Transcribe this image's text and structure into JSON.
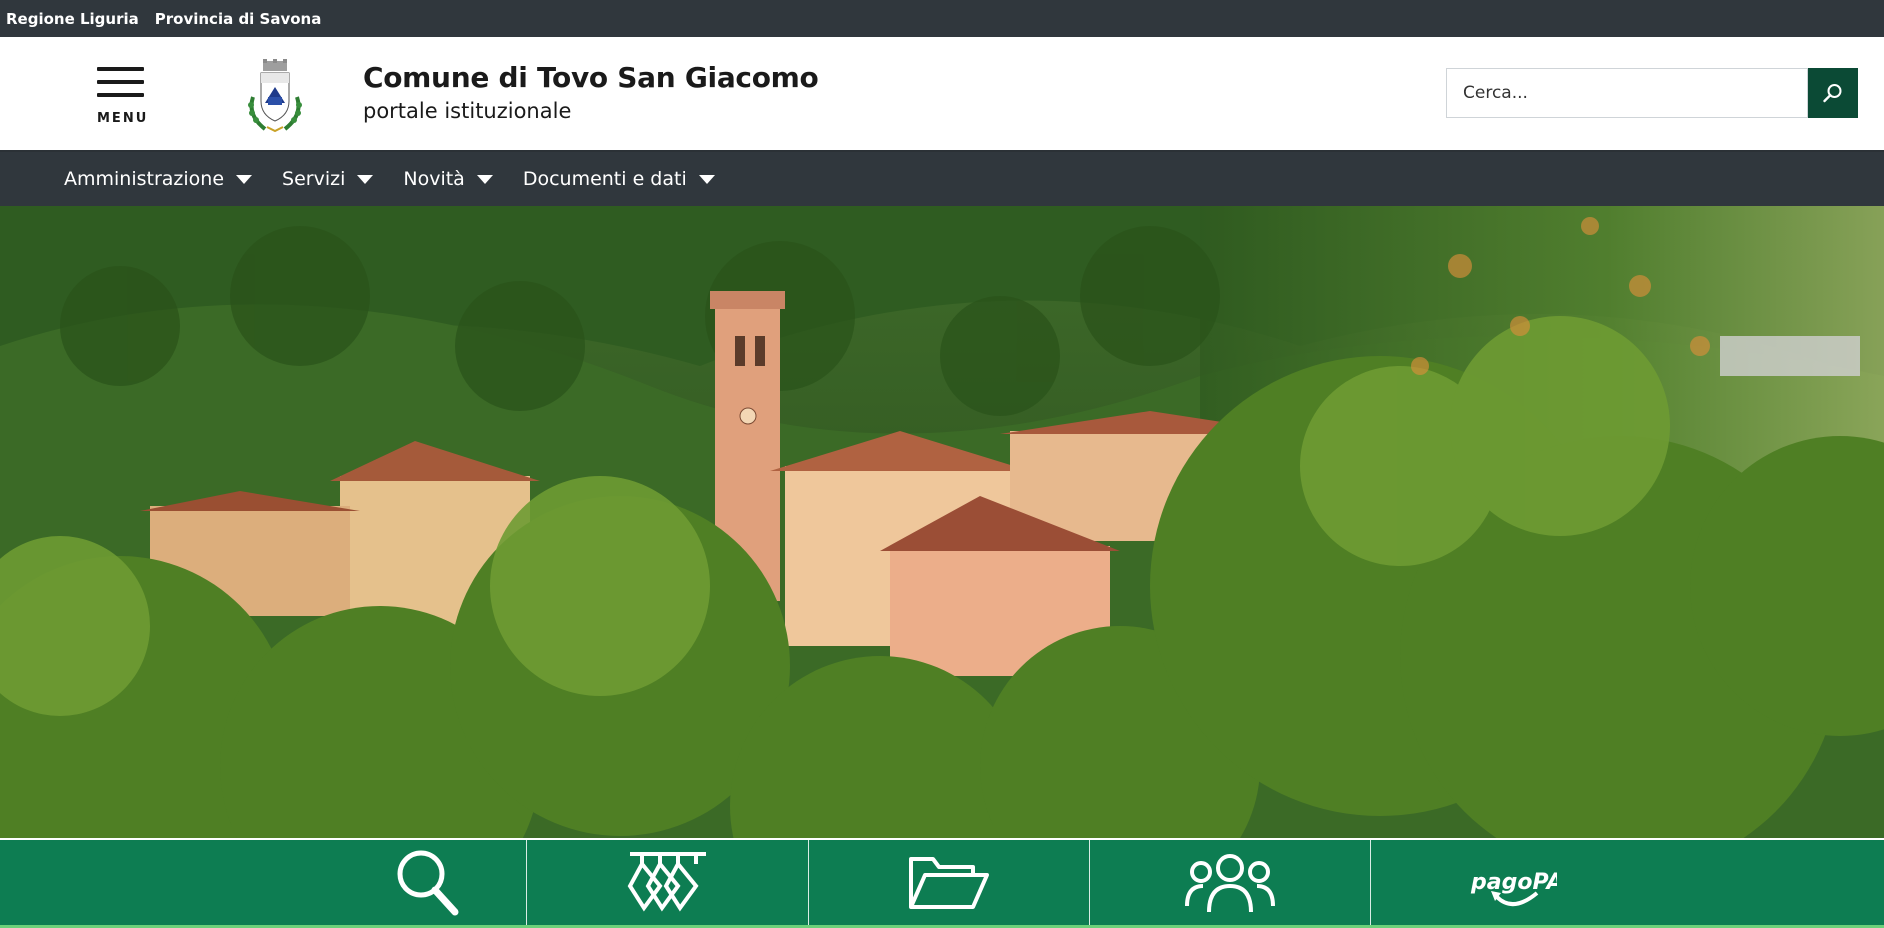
{
  "topbar": {
    "links": [
      {
        "label": "Regione Liguria"
      },
      {
        "label": "Provincia di Savona"
      }
    ]
  },
  "header": {
    "menu_label": "MENU",
    "title": "Comune di Tovo San Giacomo",
    "subtitle": "portale istituzionale",
    "crest_icon": "municipal-crest-icon",
    "search": {
      "placeholder": "Cerca...",
      "value": "",
      "button_icon": "search-icon"
    }
  },
  "nav": {
    "items": [
      {
        "label": "Amministrazione",
        "icon": "caret-down-icon"
      },
      {
        "label": "Servizi",
        "icon": "caret-down-icon"
      },
      {
        "label": "Novità",
        "icon": "caret-down-icon"
      },
      {
        "label": "Documenti e dati",
        "icon": "caret-down-icon"
      }
    ]
  },
  "hero": {
    "image": "village-church-bell-tower-hills-photo"
  },
  "quicklinks": [
    {
      "icon": "search-icon"
    },
    {
      "icon": "clothes-hanger-icon"
    },
    {
      "icon": "folder-open-icon"
    },
    {
      "icon": "people-group-icon"
    },
    {
      "icon": "pagopa-logo",
      "logo_text": "pagoPA"
    }
  ],
  "colors": {
    "topbar_bg": "#30373d",
    "search_button_bg": "#0b4a35",
    "quicklinks_bg": "#0d7d52"
  }
}
